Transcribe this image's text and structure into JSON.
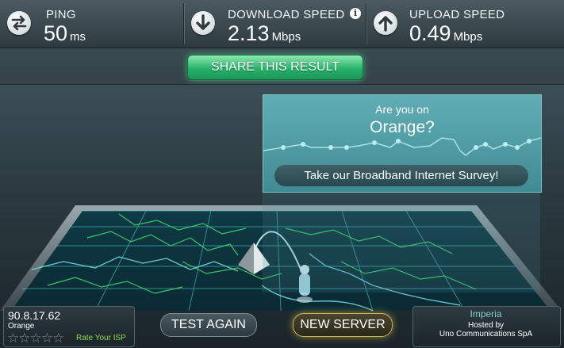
{
  "stats": {
    "ping": {
      "label": "PING",
      "value": "50",
      "unit": "ms",
      "icon": "ping-icon"
    },
    "download": {
      "label": "DOWNLOAD SPEED",
      "value": "2.13",
      "unit": "Mbps",
      "icon": "download-arrow-icon",
      "info_icon": "i"
    },
    "upload": {
      "label": "UPLOAD SPEED",
      "value": "0.49",
      "unit": "Mbps",
      "icon": "upload-arrow-icon"
    }
  },
  "share": {
    "label": "SHARE THIS RESULT"
  },
  "survey": {
    "question_line1": "Are you on",
    "question_line2": "Orange?",
    "cta": "Take our Broadband Internet Survey!"
  },
  "client": {
    "ip": "90.8.17.62",
    "isp": "Orange",
    "rating": 0,
    "rating_max": 5,
    "rate_label": "Rate Your ISP"
  },
  "buttons": {
    "test_again": "TEST AGAIN",
    "new_server": "NEW SERVER"
  },
  "server": {
    "city": "Imperia",
    "hosted_by_label": "Hosted by",
    "host": "Uno Communications SpA"
  },
  "colors": {
    "share_green": "#27b36a",
    "map_grid": "#4fd8e0",
    "map_borders": "#3fe06b",
    "survey_teal": "#4f9ba2",
    "new_server_glow": "#ffe65a",
    "rate_green": "#8cd94e"
  }
}
